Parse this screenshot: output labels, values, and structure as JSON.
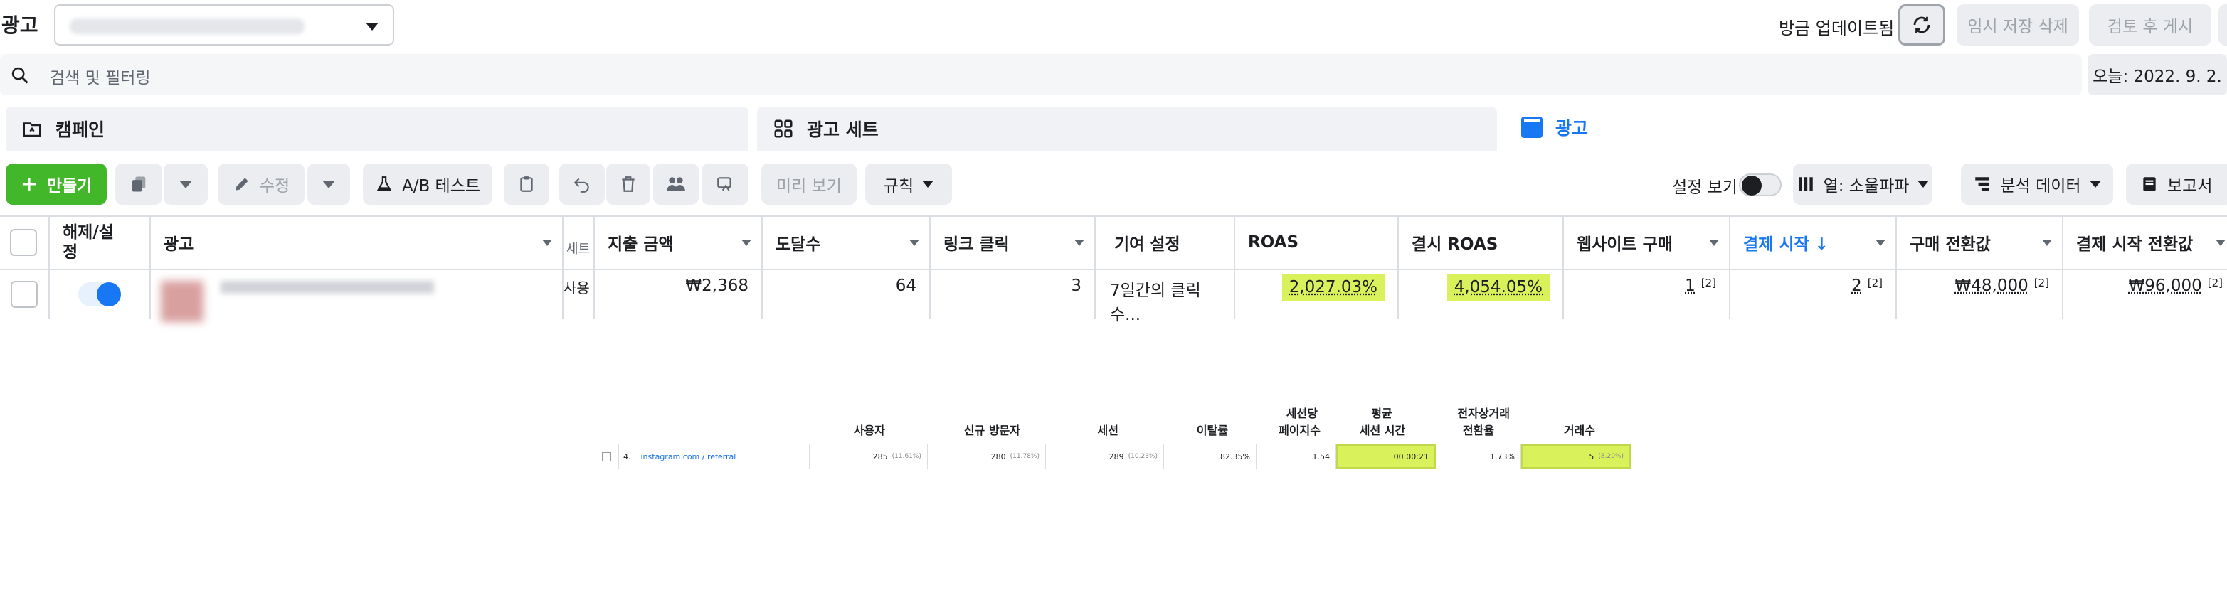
{
  "header": {
    "title": "광고",
    "account_placeholder": "(blurred)",
    "updated_label": "방금 업데이트됨",
    "discard_label": "임시 저장 삭제",
    "review_publish_label": "검토 후 게시"
  },
  "search": {
    "placeholder": "검색 및 필터링",
    "date_label": "오늘: 2022. 9. 2."
  },
  "tabs": [
    {
      "label": "캠페인"
    },
    {
      "label": "광고 세트"
    },
    {
      "label": "광고"
    }
  ],
  "toolbar": {
    "create_label": "만들기",
    "edit_label": "수정",
    "ab_test_label": "A/B 테스트",
    "preview_label": "미리 보기",
    "rules_label": "규칙",
    "view_settings_label": "설정 보기",
    "columns_label": "열: 소울파파",
    "breakdown_label": "분석 데이터",
    "reports_label": "보고서"
  },
  "table": {
    "headers": {
      "toggle": "해제/설정",
      "ad": "광고",
      "adset_partial": "세트",
      "spend": "지출 금액",
      "reach": "도달수",
      "link_clicks": "링크 클릭",
      "attribution": "기여 설정",
      "roas": "ROAS",
      "checkout_roas": "결시 ROAS",
      "purchases": "웹사이트 구매",
      "checkouts": "결제 시작 ↓",
      "purchase_value": "구매 전환값",
      "checkout_value": "결제 시작 전환값"
    },
    "row": {
      "adset_partial": "사용",
      "spend": "₩2,368",
      "reach": "64",
      "link_clicks": "3",
      "attribution": "7일간의 클릭수...",
      "roas": "2,027.03%",
      "checkout_roas": "4,054.05%",
      "purchases": "1",
      "purchases_sup": "[2]",
      "checkouts": "2",
      "checkouts_sup": "[2]",
      "purchase_value": "₩48,000",
      "purchase_value_sup": "[2]",
      "checkout_value": "₩96,000",
      "checkout_value_sup": "[2]"
    }
  },
  "analytics": {
    "headers": {
      "users": "사용자",
      "new_users": "신규 방문자",
      "sessions": "세션",
      "bounce": "이탈률",
      "pages_line1": "세션당",
      "pages_line2": "페이지수",
      "avg_line1": "평균",
      "avg_line2": "세션 시간",
      "ecom_line1": "전자상거래",
      "ecom_line2": "전환율",
      "transactions": "거래수"
    },
    "row": {
      "index": "4.",
      "source": "instagram.com / referral",
      "users": "285",
      "users_pct": "(11.61%)",
      "new_users": "280",
      "new_users_pct": "(11.78%)",
      "sessions": "289",
      "sessions_pct": "(10.23%)",
      "bounce": "82.35%",
      "pages": "1.54",
      "avg_time": "00:00:21",
      "ecom_rate": "1.73%",
      "transactions": "5",
      "transactions_pct": "(8.20%)"
    }
  },
  "colors": {
    "accent": "#1877f2",
    "create_green": "#42b72a",
    "highlight": "#d9f15b"
  }
}
